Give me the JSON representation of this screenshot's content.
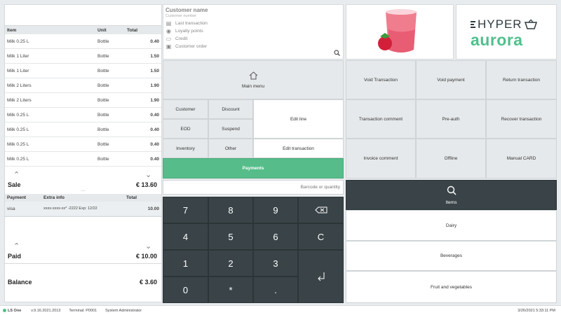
{
  "items_table": {
    "headers": {
      "item": "Item",
      "unit": "Unit",
      "total": "Total"
    },
    "rows": [
      {
        "item": "Milk 0.25 L",
        "unit": "Bottle",
        "total": "0.40"
      },
      {
        "item": "Milk 1 Liter",
        "unit": "Bottle",
        "total": "1.50"
      },
      {
        "item": "Milk 1 Liter",
        "unit": "Bottle",
        "total": "1.50"
      },
      {
        "item": "Milk 2 Liters",
        "unit": "Bottle",
        "total": "1.90"
      },
      {
        "item": "Milk 2 Liters",
        "unit": "Bottle",
        "total": "1.90"
      },
      {
        "item": "Milk 0.25 L",
        "unit": "Bottle",
        "total": "0.40"
      },
      {
        "item": "Milk 0.25 L",
        "unit": "Bottle",
        "total": "0.40"
      },
      {
        "item": "Milk 0.25 L",
        "unit": "Bottle",
        "total": "0.40"
      },
      {
        "item": "Milk 0.25 L",
        "unit": "Bottle",
        "total": "0.40"
      }
    ]
  },
  "sale": {
    "label": "Sale",
    "amount": "€ 13.60"
  },
  "payments_table": {
    "headers": {
      "payment": "Payment",
      "extra": "Extra info",
      "total": "Total"
    },
    "rows": [
      {
        "payment": "visa",
        "extra": "xxxx-xxxx-xx* -2222 Exp: 12/22",
        "total": "10.00"
      }
    ]
  },
  "paid": {
    "label": "Paid",
    "amount": "€ 10.00"
  },
  "balance": {
    "label": "Balance",
    "amount": "€ 3.60"
  },
  "customer": {
    "name_label": "Customer name",
    "number_label": "Customer number",
    "lines": [
      "Last transaction",
      "Loyalty points",
      "Credit",
      "Customer order"
    ]
  },
  "logo": {
    "line1": "HYPER",
    "line2": "aurora",
    "color_dark": "#2f3a3f",
    "color_green": "#4fc08d"
  },
  "buttons": {
    "main_menu": "Main menu",
    "customer": "Customer",
    "discount": "Discount",
    "edit_line": "Edit line",
    "eod": "EOD",
    "suspend": "Suspend",
    "inventory": "Inventory",
    "other": "Other",
    "edit_transaction": "Edit transaction",
    "payments": "Payments",
    "void_transaction": "Void Transaction",
    "void_payment": "Void payment",
    "return_transaction": "Return transaction",
    "transaction_comment": "Transaction comment",
    "pre_auth": "Pre-auth",
    "recover_transaction": "Recover transaction",
    "invoice_comment": "Invoice comment",
    "offline": "Offline",
    "manual_card": "Manual CARD",
    "items": "Items",
    "dairy": "Dairy",
    "beverages": "Beverages",
    "fruit_veg": "Fruit and  vegetables"
  },
  "barcode": {
    "placeholder": "Barcode or quantity"
  },
  "keypad": {
    "k7": "7",
    "k8": "8",
    "k9": "9",
    "k4": "4",
    "k5": "5",
    "k6": "6",
    "k1": "1",
    "k2": "2",
    "k3": "3",
    "k0": "0",
    "star": "*",
    "dot": ".",
    "clear": "C"
  },
  "status": {
    "brand": "LS One",
    "version": "v.9.16.2021.2013",
    "terminal": "Terminal: P0001",
    "user": "System Administrator",
    "datetime": "3/26/2021 5:33:11 PM"
  },
  "colors": {
    "accent_green": "#56bd8a",
    "keypad_dark": "#3a4448"
  }
}
